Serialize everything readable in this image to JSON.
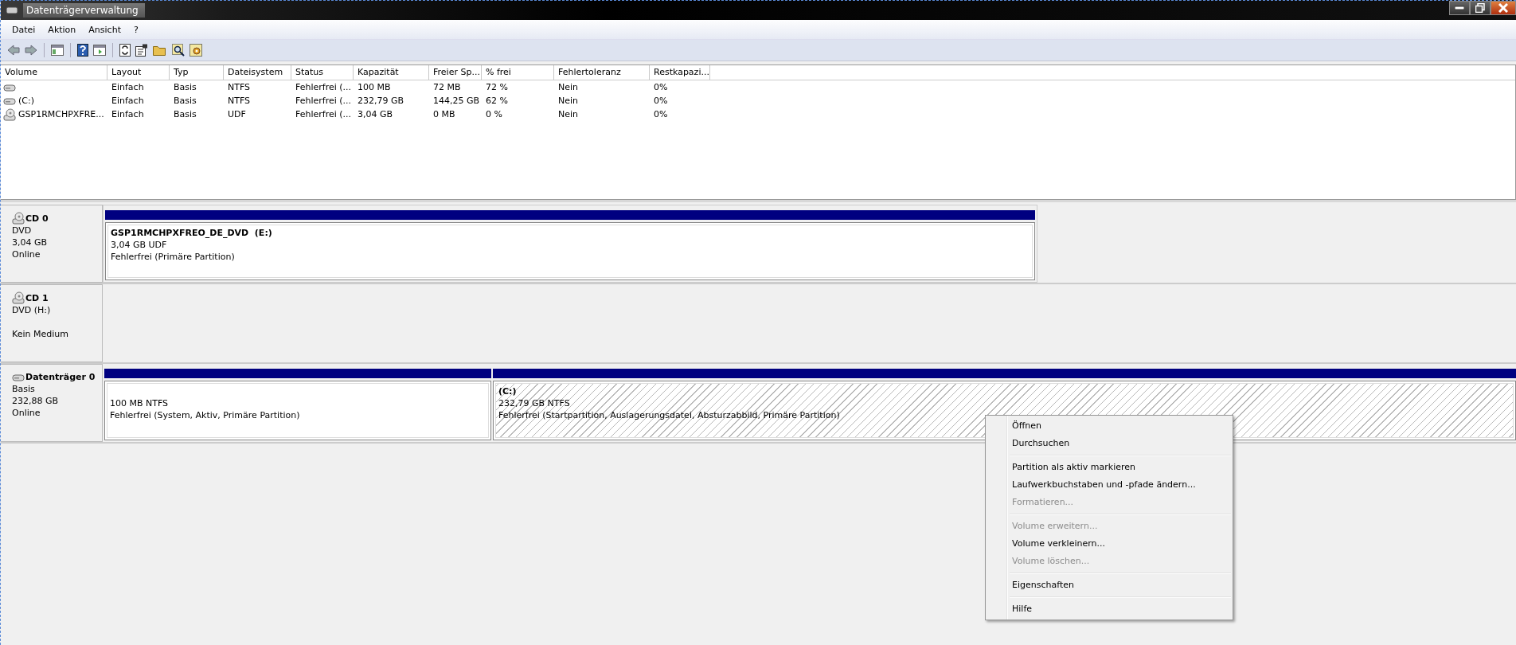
{
  "window": {
    "title": "Datenträgerverwaltung"
  },
  "menu": [
    "Datei",
    "Aktion",
    "Ansicht",
    "?"
  ],
  "table": {
    "columns": [
      "Volume",
      "Layout",
      "Typ",
      "Dateisystem",
      "Status",
      "Kapazität",
      "Freier Sp...",
      "% frei",
      "Fehlertoleranz",
      "Restkapazi..."
    ],
    "rows": [
      {
        "kind": "disk",
        "cells": [
          "",
          "Einfach",
          "Basis",
          "NTFS",
          "Fehlerfrei (...",
          "100 MB",
          "72 MB",
          "72 %",
          "Nein",
          "0%"
        ]
      },
      {
        "kind": "disk",
        "cells": [
          "(C:)",
          "Einfach",
          "Basis",
          "NTFS",
          "Fehlerfrei (...",
          "232,79 GB",
          "144,25 GB",
          "62 %",
          "Nein",
          "0%"
        ]
      },
      {
        "kind": "cd",
        "cells": [
          "GSP1RMCHPXFRE...",
          "Einfach",
          "Basis",
          "UDF",
          "Fehlerfrei (...",
          "3,04 GB",
          "0 MB",
          "0 %",
          "Nein",
          "0%"
        ]
      }
    ]
  },
  "disks": [
    {
      "kind": "cd",
      "name": "CD 0",
      "type": "DVD",
      "size": "3,04 GB",
      "status": "Online",
      "partitions": [
        {
          "title": "GSP1RMCHPXFREO_DE_DVD  (E:)",
          "size": "3,04 GB UDF",
          "status": "Fehlerfrei (Primäre Partition)",
          "selected": false
        }
      ]
    },
    {
      "kind": "cd",
      "name": "CD 1",
      "type": "DVD (H:)",
      "status": "Kein Medium"
    },
    {
      "kind": "disk",
      "name": "Datenträger 0",
      "type": "Basis",
      "size": "232,88 GB",
      "status": "Online",
      "partitions": [
        {
          "size": "100 MB NTFS",
          "status": "Fehlerfrei (System, Aktiv, Primäre Partition)",
          "selected": false
        },
        {
          "title": "(C:)",
          "size": "232,79 GB NTFS",
          "status": "Fehlerfrei (Startpartition, Auslagerungsdatei, Absturzabbild, Primäre Partition)",
          "selected": true
        }
      ]
    }
  ],
  "context_menu": {
    "groups": [
      [
        {
          "label": "Öffnen",
          "disabled": false
        },
        {
          "label": "Durchsuchen",
          "disabled": false
        }
      ],
      [
        {
          "label": "Partition als aktiv markieren",
          "disabled": false
        },
        {
          "label": "Laufwerkbuchstaben und -pfade ändern...",
          "disabled": false
        },
        {
          "label": "Formatieren...",
          "disabled": true
        }
      ],
      [
        {
          "label": "Volume erweitern...",
          "disabled": true
        },
        {
          "label": "Volume verkleinern...",
          "disabled": false
        },
        {
          "label": "Volume löschen...",
          "disabled": true
        }
      ],
      [
        {
          "label": "Eigenschaften",
          "disabled": false
        }
      ],
      [
        {
          "label": "Hilfe",
          "disabled": false
        }
      ]
    ]
  }
}
